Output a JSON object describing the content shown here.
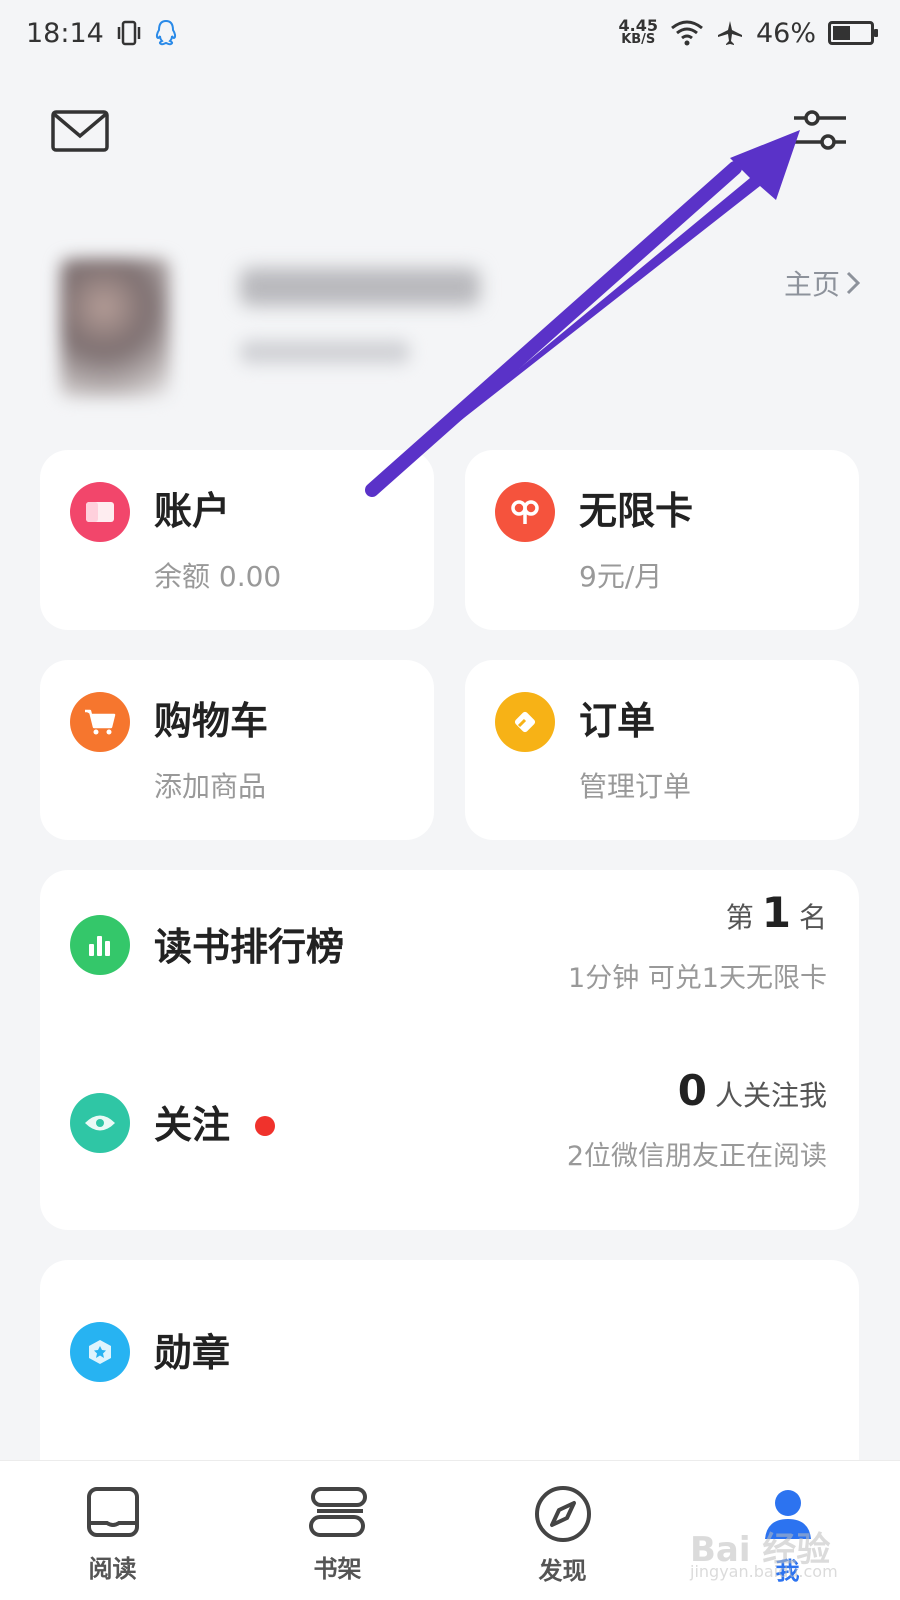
{
  "status_bar": {
    "time": "18:14",
    "net_speed_value": "4.45",
    "net_speed_unit": "KB/S",
    "battery": "46%",
    "icons": [
      "vibrate-icon",
      "qq-icon",
      "wifi-icon",
      "airplane-icon",
      "battery-icon"
    ]
  },
  "header": {
    "mail_icon": "mail-icon",
    "settings_icon": "sliders-icon"
  },
  "profile": {
    "homepage_label": "主页"
  },
  "cards": {
    "account": {
      "title": "账户",
      "sub": "余额 0.00",
      "icon": "wallet-icon",
      "color": "#f2466b"
    },
    "unlimited": {
      "title": "无限卡",
      "sub": "9元/月",
      "icon": "infinity-icon",
      "color": "#f5533d"
    },
    "cart": {
      "title": "购物车",
      "sub": "添加商品",
      "icon": "cart-icon",
      "color": "#f6762e"
    },
    "orders": {
      "title": "订单",
      "sub": "管理订单",
      "icon": "order-icon",
      "color": "#f7b216"
    }
  },
  "ranking": {
    "title": "读书排行榜",
    "rank_prefix": "第",
    "rank_value": "1",
    "rank_suffix": "名",
    "sub": "1分钟 可兑1天无限卡",
    "icon": "bar-chart-icon",
    "color": "#34c76a"
  },
  "follow": {
    "title": "关注",
    "count": "0",
    "count_suffix": "人关注我",
    "sub": "2位微信朋友正在阅读",
    "icon": "eye-icon",
    "color": "#2fc6a5"
  },
  "medals": {
    "title": "勋章",
    "icon": "medal-icon",
    "color": "#27b3f2"
  },
  "tabbar": {
    "tabs": [
      {
        "label": "阅读",
        "icon": "book-icon"
      },
      {
        "label": "书架",
        "icon": "bookshelf-icon"
      },
      {
        "label": "发现",
        "icon": "compass-icon"
      },
      {
        "label": "我",
        "icon": "person-icon"
      }
    ],
    "active_index": 3
  },
  "watermark": {
    "main": "Bai 经验",
    "sub": "jingyan.baidu.com"
  },
  "annotation_color": "#5a32c8"
}
